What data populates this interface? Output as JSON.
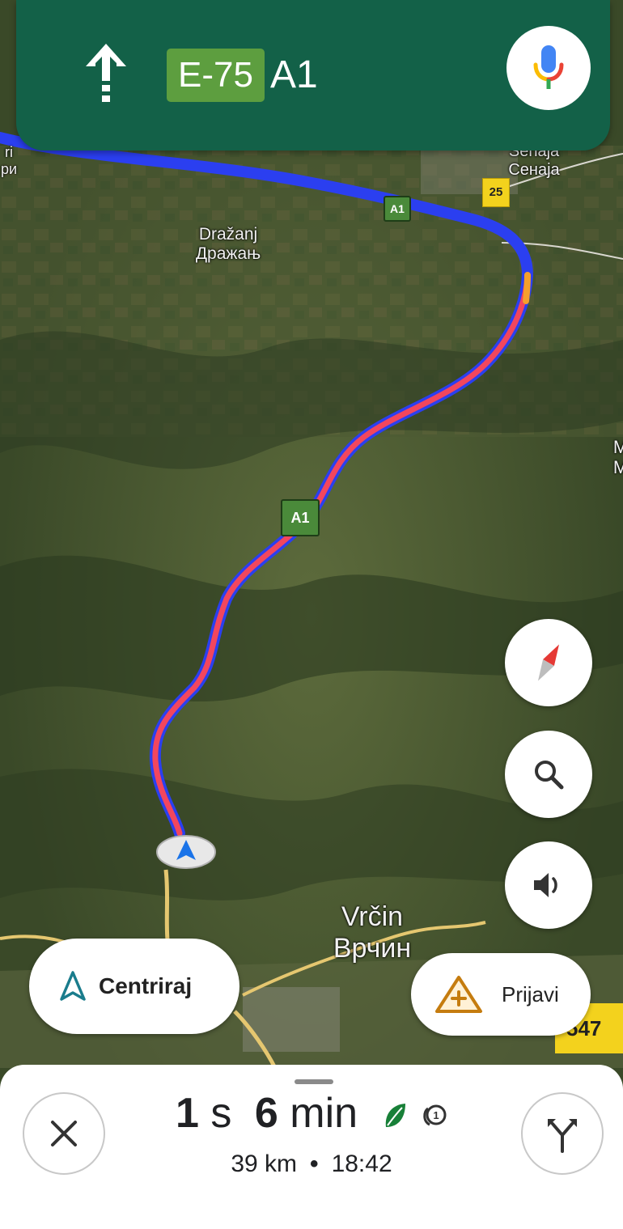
{
  "header": {
    "maneuver_icon": "straight-arrow-icon",
    "route_badge": "E-75",
    "road_name": "A1",
    "mic_icon": "microphone-icon"
  },
  "map": {
    "places": {
      "drazanj_latin": "Dražanj",
      "drazanj_cyrillic": "Дражањ",
      "vrcin_latin": "Vrčin",
      "vrcin_cyrillic": "Врчин",
      "senaja_latin": "Senaja",
      "senaja_cyrillic": "Сенаја",
      "edge_left_1": "ri",
      "edge_left_2": "ри",
      "edge_right_1": "M",
      "edge_right_2": "M"
    },
    "road_shields": {
      "a1_top": "A1",
      "a1_mid": "A1",
      "road_25": "25",
      "road_547": "547"
    },
    "colors": {
      "route_blue": "#2b3ff0",
      "traffic_red": "#f2465e",
      "traffic_orange": "#f5a02c"
    }
  },
  "controls": {
    "recenter_label": "Centriraj",
    "report_label": "Prijavi"
  },
  "trip": {
    "hours": "1",
    "hours_unit": "s",
    "minutes": "6",
    "minutes_unit": "min",
    "distance": "39 km",
    "separator": "•",
    "arrival_time": "18:42",
    "eco_icon": "leaf-icon",
    "toll_icon": "toll-icon"
  }
}
